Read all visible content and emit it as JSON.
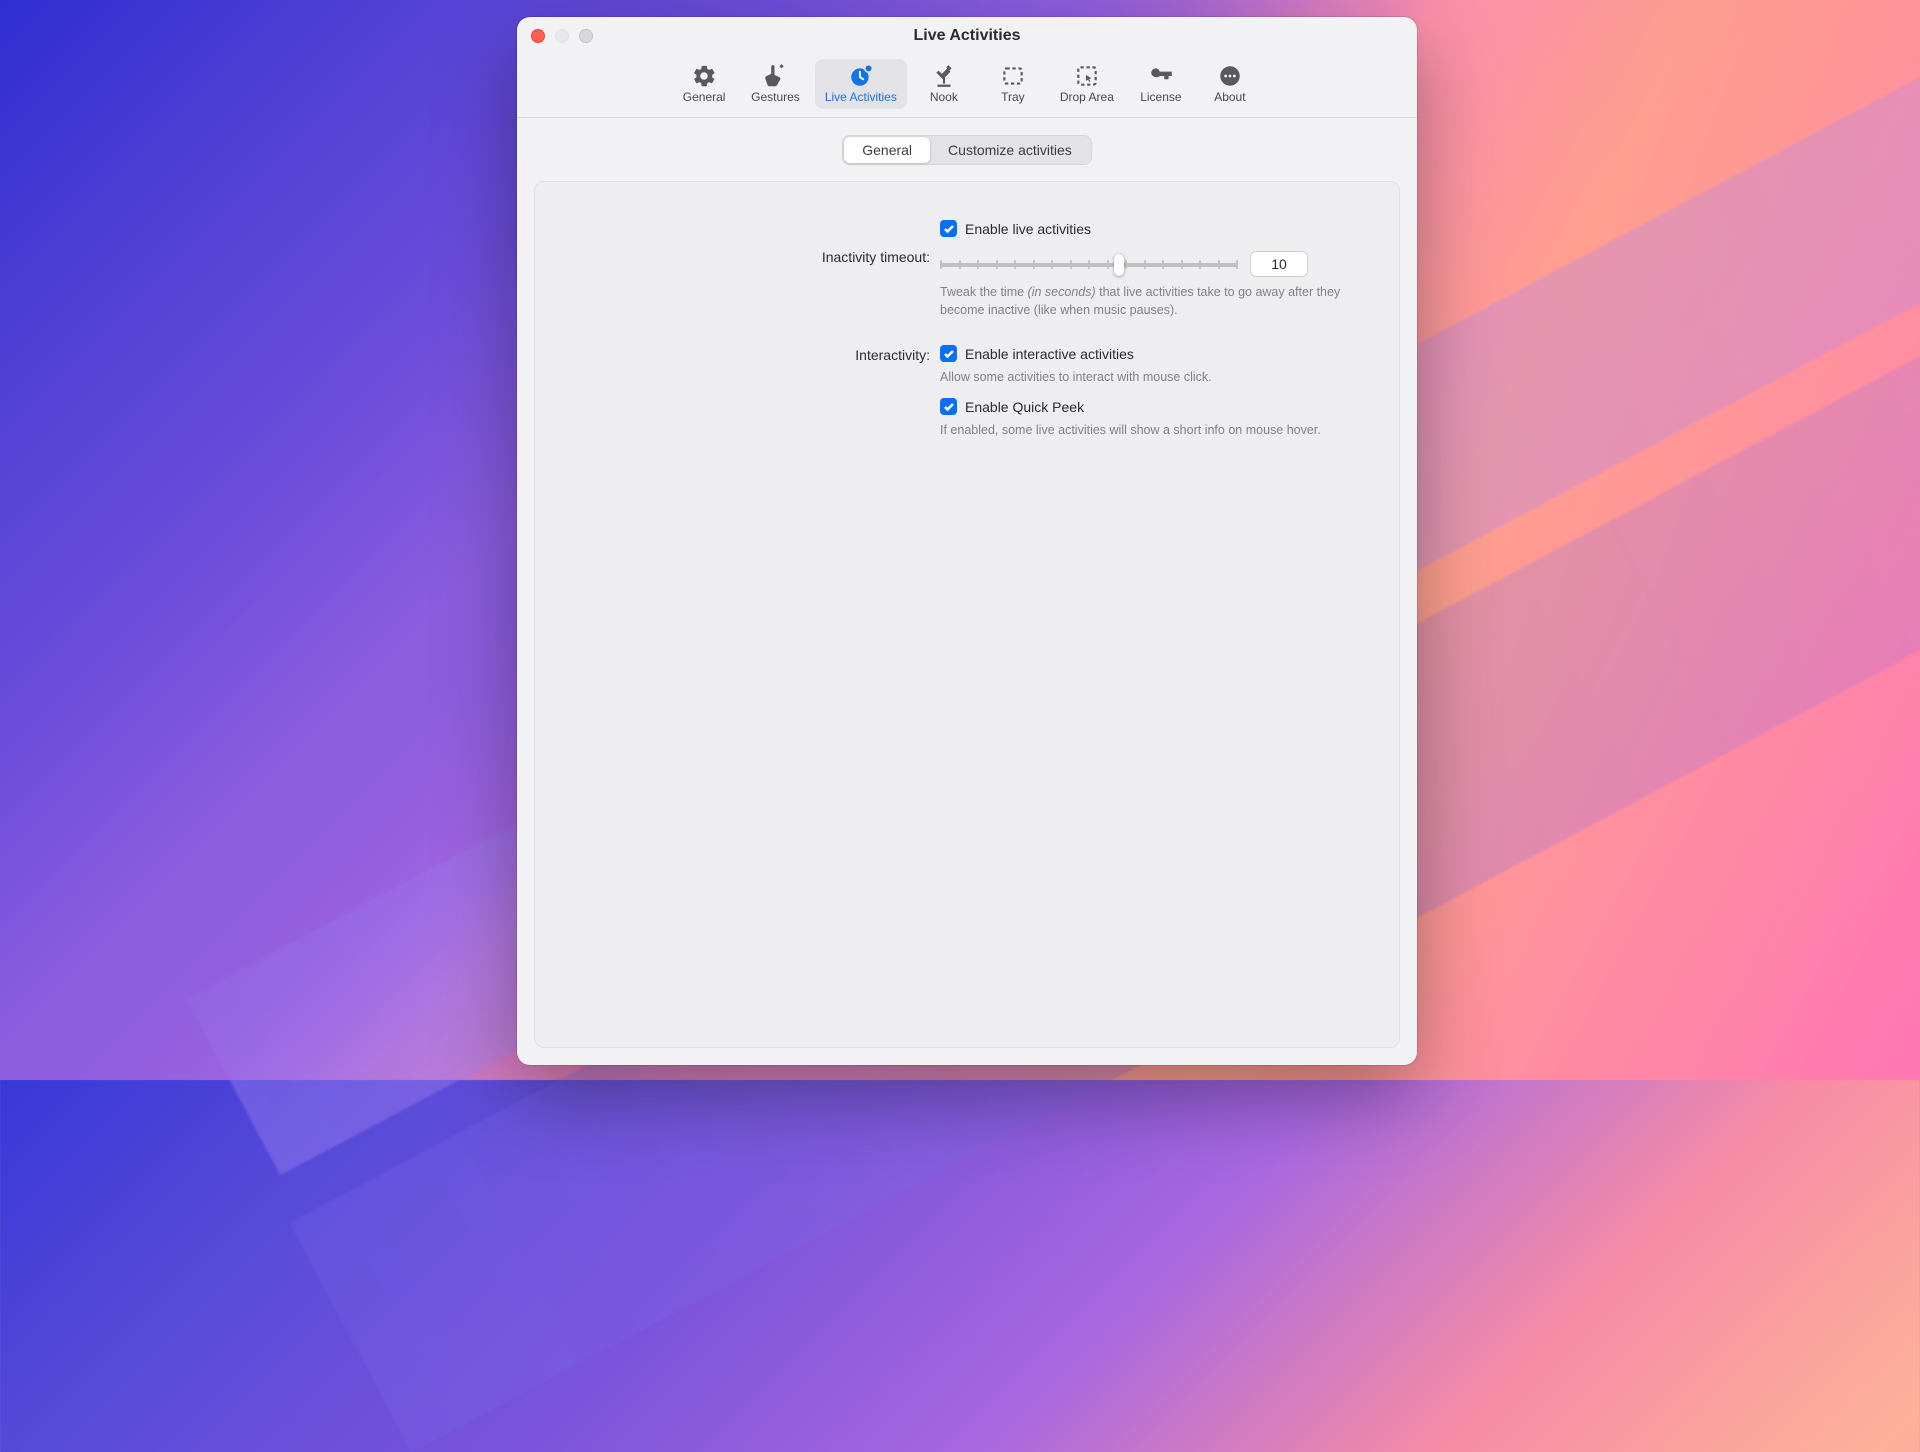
{
  "window": {
    "title": "Live Activities"
  },
  "toolbar": {
    "items": [
      {
        "label": "General"
      },
      {
        "label": "Gestures"
      },
      {
        "label": "Live Activities"
      },
      {
        "label": "Nook"
      },
      {
        "label": "Tray"
      },
      {
        "label": "Drop Area"
      },
      {
        "label": "License"
      },
      {
        "label": "About"
      }
    ],
    "active_index": 2
  },
  "segment": {
    "options": [
      "General",
      "Customize activities"
    ],
    "active_index": 0
  },
  "settings": {
    "enable_live": {
      "checked": true,
      "label": "Enable live activities"
    },
    "timeout": {
      "label": "Inactivity timeout:",
      "value": "10",
      "slider_percent": 60,
      "help_pre": "Tweak the time ",
      "help_em": "(in seconds)",
      "help_post": " that live activities take to go away after they become inactive (like when music pauses)."
    },
    "interactivity_label": "Interactivity:",
    "enable_interactive": {
      "checked": true,
      "label": "Enable interactive activities",
      "help": "Allow some activities to interact with mouse click."
    },
    "quick_peek": {
      "checked": true,
      "label": "Enable Quick Peek",
      "help": "If enabled, some live activities will show a short info on mouse hover."
    }
  }
}
